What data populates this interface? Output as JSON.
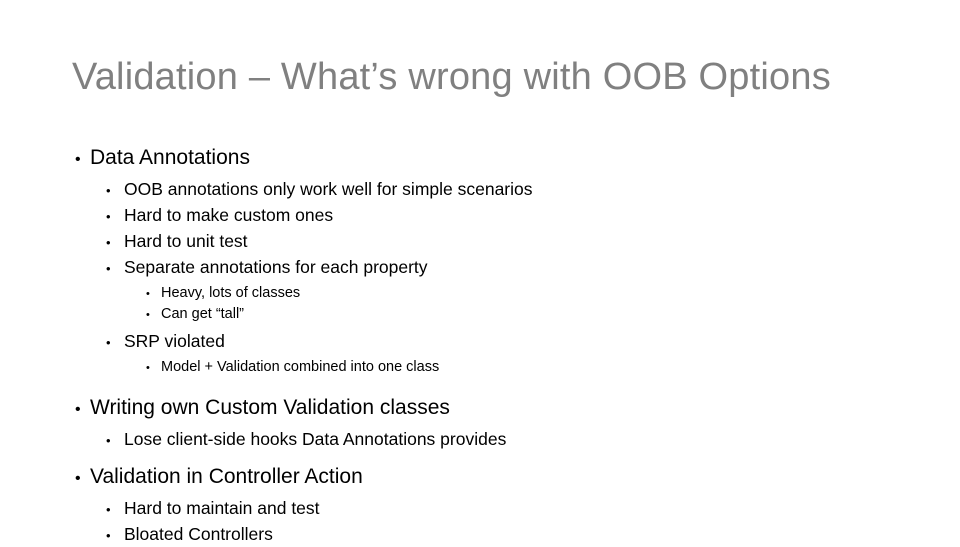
{
  "slide": {
    "title": "Validation – What’s wrong with OOB Options",
    "title_color": "#808080",
    "background_color": "#ffffff",
    "body_text_color": "#000000",
    "bullet_glyph": "•",
    "outline": [
      {
        "level": 1,
        "text": "Data Annotations"
      },
      {
        "level": 2,
        "text": "OOB annotations only work well for simple scenarios"
      },
      {
        "level": 2,
        "text": "Hard to make custom ones"
      },
      {
        "level": 2,
        "text": "Hard to unit test"
      },
      {
        "level": 2,
        "text": "Separate annotations for each property"
      },
      {
        "level": 3,
        "text": "Heavy, lots of classes"
      },
      {
        "level": 3,
        "text": "Can get “tall”"
      },
      {
        "level": 2,
        "text": "SRP violated"
      },
      {
        "level": 3,
        "text": "Model + Validation combined into one class"
      },
      {
        "level": 1,
        "text": "Writing own Custom Validation classes"
      },
      {
        "level": 2,
        "text": "Lose client-side hooks Data Annotations provides"
      },
      {
        "level": 1,
        "text": "Validation in Controller Action"
      },
      {
        "level": 2,
        "text": "Hard to maintain and test"
      },
      {
        "level": 2,
        "text": "Bloated Controllers"
      }
    ]
  }
}
